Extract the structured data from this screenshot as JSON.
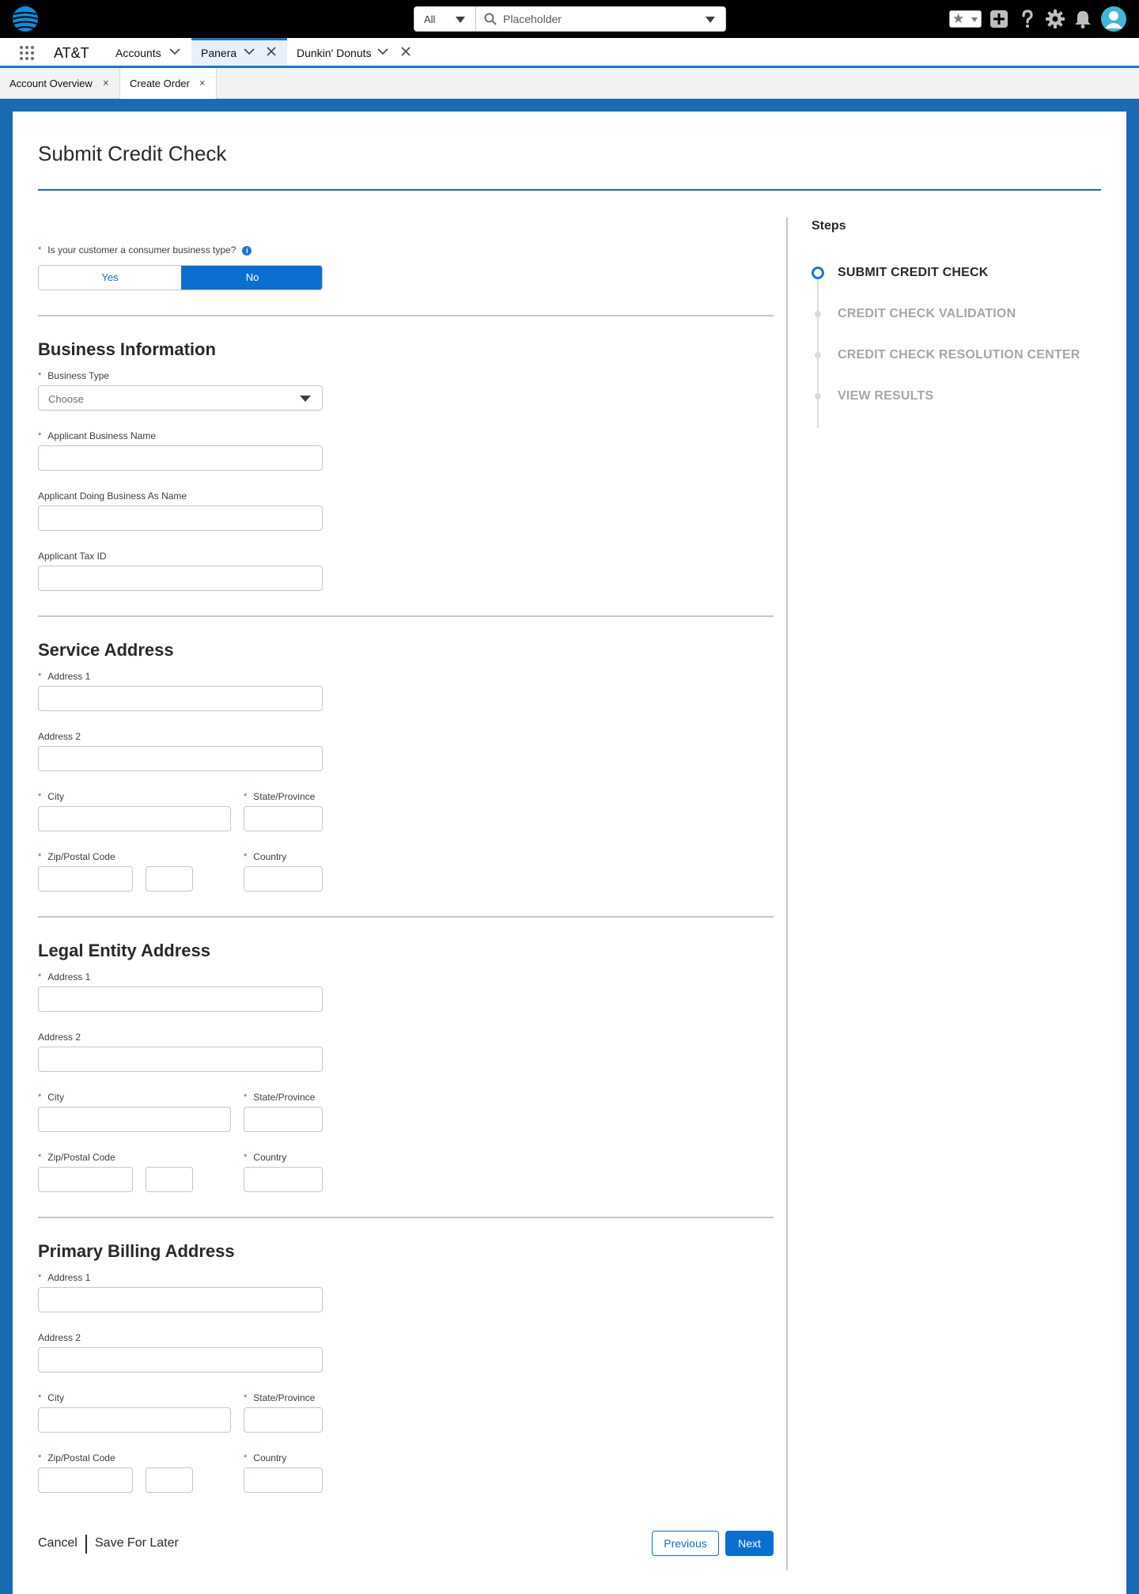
{
  "topbar": {
    "search_scope": "All",
    "search_placeholder": "Placeholder",
    "icons": [
      "att-globe-icon",
      "star-icon",
      "add-icon",
      "help-icon",
      "gear-icon",
      "bell-icon",
      "user-avatar-icon"
    ]
  },
  "appnav": {
    "app_name": "AT&T",
    "tabs": [
      {
        "label": "Accounts"
      },
      {
        "label": "Panera"
      },
      {
        "label": "Dunkin' Donuts"
      }
    ]
  },
  "subtabs": [
    {
      "label": "Account Overview"
    },
    {
      "label": "Create Order"
    }
  ],
  "page": {
    "title": "Submit Credit Check",
    "consumer_question": "Is your customer a consumer business type?",
    "toggle": {
      "yes": "Yes",
      "no": "No",
      "selected": "No"
    },
    "business": {
      "title": "Business Information",
      "business_type_label": "Business Type",
      "business_type_value": "Choose",
      "applicant_name_label": "Applicant Business Name",
      "dba_label": "Applicant Doing Business As Name",
      "tax_id_label": "Applicant Tax ID"
    },
    "address_labels": {
      "address1": "Address 1",
      "address2": "Address 2",
      "city": "City",
      "state": "State/Province",
      "zip": "Zip/Postal Code",
      "country": "Country"
    },
    "sections": {
      "service": "Service Address",
      "legal": "Legal Entity Address",
      "billing": "Primary Billing Address"
    },
    "steps": {
      "title": "Steps",
      "items": [
        "SUBMIT CREDIT CHECK",
        "CREDIT CHECK VALIDATION",
        "CREDIT CHECK RESOLUTION CENTER",
        "VIEW RESULTS"
      ],
      "current": "SUBMIT CREDIT CHECK"
    },
    "footer": {
      "cancel": "Cancel",
      "save_for_later": "Save For Later",
      "previous": "Previous",
      "next": "Next"
    }
  },
  "colors": {
    "brand": "#0b6fd1",
    "background": "#1a6bb3",
    "required": "#c23934"
  }
}
